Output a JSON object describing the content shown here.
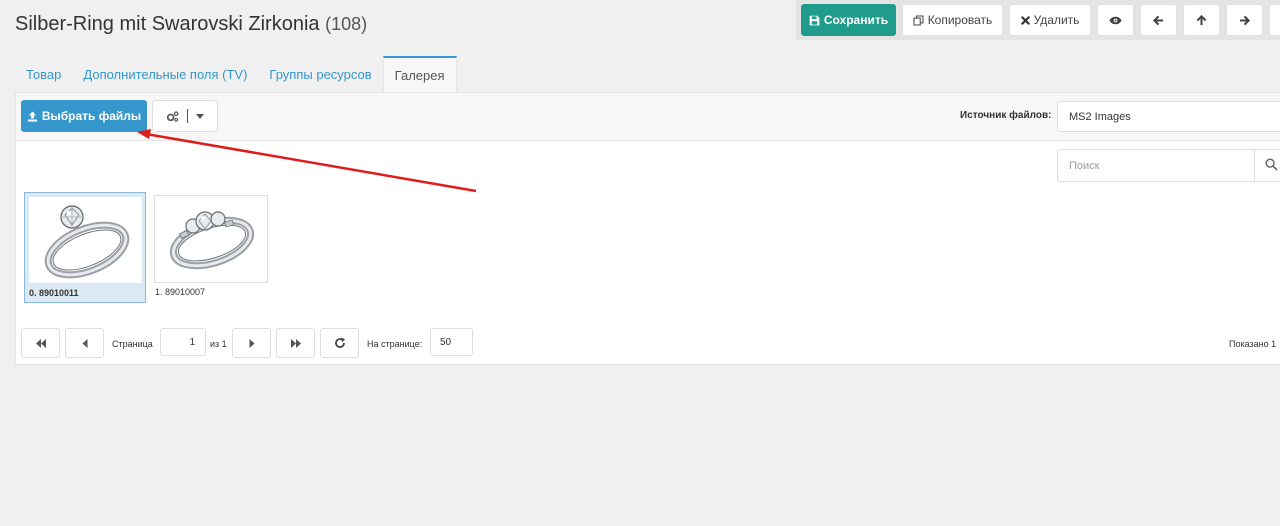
{
  "header": {
    "title": "Silber-Ring mit Swarovski Zirkonia",
    "count": "(108)"
  },
  "toolbar": {
    "save_label": "Сохранить",
    "copy_label": "Копировать",
    "delete_label": "Удалить"
  },
  "tabs": [
    {
      "label": "Товар"
    },
    {
      "label": "Дополнительные поля (TV)"
    },
    {
      "label": "Группы ресурсов"
    },
    {
      "label": "Галерея"
    }
  ],
  "gallery": {
    "upload_label": "Выбрать файлы",
    "source_label": "Источник файлов:",
    "source_value": "MS2 Images",
    "search_placeholder": "Поиск",
    "items": [
      {
        "caption": "0. 89010011"
      },
      {
        "caption": "1. 89010007"
      }
    ]
  },
  "pagination": {
    "page_label": "Страница",
    "page_value": "1",
    "of_label": "из 1",
    "per_page_label": "На странице:",
    "per_page_value": "50",
    "shown_label": "Показано 1"
  },
  "colors": {
    "save": "#1f9c8b",
    "primary": "#3697cd",
    "annotation_arrow": "#e01b1b"
  }
}
